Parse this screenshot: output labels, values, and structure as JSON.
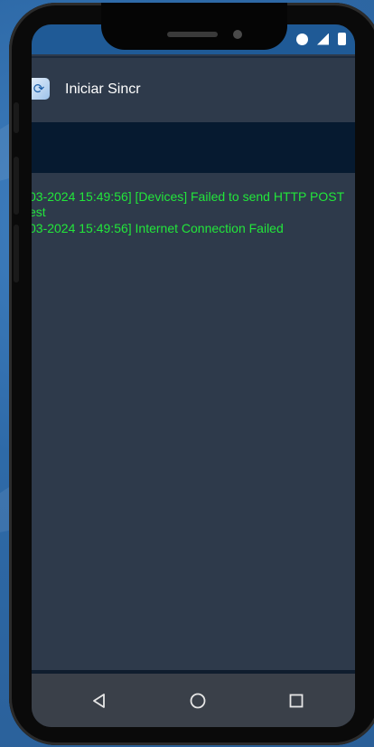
{
  "app": {
    "title": "Iniciar Sincr"
  },
  "log": {
    "lines": [
      "03-2024 15:49:56] [Devices] Failed to send HTTP POST",
      "est",
      "03-2024 15:49:56] Internet Connection Failed"
    ]
  },
  "icons": {
    "app": "sync-app-icon",
    "status": [
      "dnd-icon",
      "signal-icon",
      "battery-icon"
    ],
    "nav": [
      "back-icon",
      "home-icon",
      "recents-icon"
    ]
  },
  "colors": {
    "log_text": "#22e63a",
    "status_bar": "#1f5a96",
    "app_bar": "#2e3a4b",
    "tab_strip": "#061a30",
    "nav_bar": "#3a4049"
  }
}
